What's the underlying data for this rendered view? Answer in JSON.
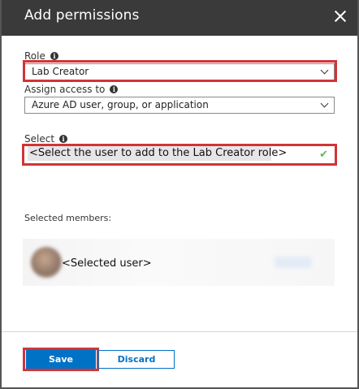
{
  "header": {
    "title": "Add permissions",
    "close_icon": "close-icon"
  },
  "role": {
    "label": "Role",
    "value": "Lab Creator"
  },
  "assign_access": {
    "label": "Assign access to",
    "value": "Azure AD user, group, or application"
  },
  "select": {
    "label": "Select",
    "value": "<Select the user to add to the Lab Creator role>",
    "status_icon": "check-icon"
  },
  "selected_members": {
    "label": "Selected members:",
    "items": [
      {
        "name": "<Selected user>"
      }
    ]
  },
  "footer": {
    "save_label": "Save",
    "discard_label": "Discard"
  },
  "colors": {
    "title_bar": "#3a3a3a",
    "accent": "#0072c6",
    "highlight": "#d13438",
    "valid": "#5cb85c"
  }
}
